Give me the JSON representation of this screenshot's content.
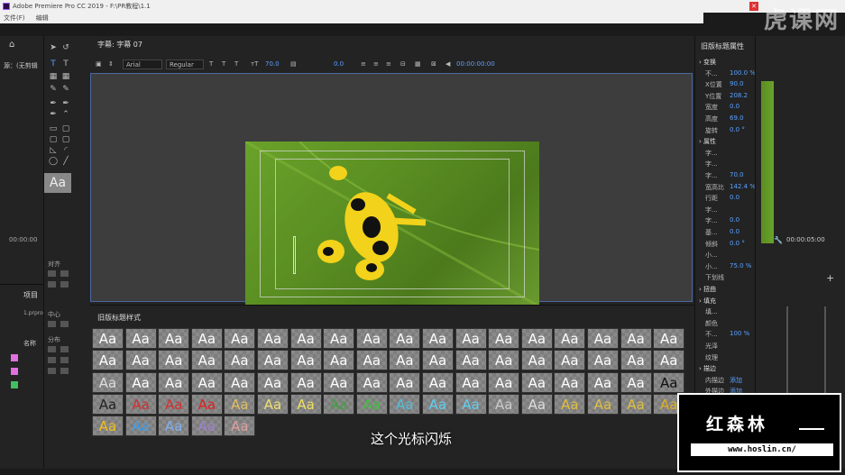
{
  "window": {
    "title": "Adobe Premiere Pro CC 2019 - F:\\PR教程\\1.1"
  },
  "watermark": "虎课网",
  "menu": [
    "文件(F)",
    "编辑"
  ],
  "source_panel": {
    "label": "源：(无剪辑",
    "timecode": "00:00:00"
  },
  "tools_panel": {
    "align_label": "对齐",
    "center_label": "中心",
    "distribute_label": "分布",
    "aa_label": "Aa"
  },
  "project_panel": {
    "tab": "项目",
    "file": "1.prpro",
    "name_col": "名称"
  },
  "title_panel": {
    "tab": "字幕: 字幕 07",
    "font_family": "Arial",
    "font_style": "Regular",
    "font_size": "70.0",
    "kerning": "0.0",
    "timecode": "00:00:00:00"
  },
  "styles_panel": {
    "tab": "旧版标题样式",
    "rows": [
      [
        "Aa",
        "Aa",
        "Aa",
        "Aa",
        "Aa",
        "Aa",
        "Aa",
        "Aa",
        "Aa",
        "Aa",
        "Aa",
        "Aa",
        "Aa",
        "Aa",
        "Aa",
        "Aa",
        "Aa",
        "Aa"
      ],
      [
        "Aa",
        "Aa",
        "Aa",
        "Aa",
        "Aa",
        "Aa",
        "Aa",
        "Aa",
        "Aa",
        "Aa",
        "Aa",
        "Aa",
        "Aa",
        "Aa",
        "Aa",
        "Aa",
        "Aa",
        "Aa"
      ],
      [
        "Aa",
        "Aa",
        "Aa",
        "Aa",
        "Aa",
        "Aa",
        "Aa",
        "Aa",
        "Aa",
        "Aa",
        "Aa",
        "Aa",
        "Aa",
        "Aa",
        "Aa",
        "Aa",
        "Aa",
        "Aa"
      ],
      [
        "Aa",
        "Aa",
        "Aa",
        "Aa",
        "Aa",
        "Aa",
        "Aa",
        "Aa",
        "Aa",
        "Aa",
        "Aa",
        "Aa",
        "Aa",
        "Aa",
        "Aa",
        "Aa",
        "Aa",
        "Aa"
      ],
      [
        "Aa",
        "Aa",
        "Aa",
        "Aa",
        "Aa"
      ]
    ],
    "colors": [
      [
        "#ffffff",
        "#ffffff",
        "#ffffff",
        "#ffffff",
        "#ffffff",
        "#ffffff",
        "#ffffff",
        "#ffffff",
        "#ffffff",
        "#ffffff",
        "#ffffff",
        "#ffffff",
        "#ffffff",
        "#ffffff",
        "#ffffff",
        "#ffffff",
        "#ffffff",
        "#ffffff"
      ],
      [
        "#ffffff",
        "#ffffff",
        "#ffffff",
        "#ffffff",
        "#ffffff",
        "#ffffff",
        "#ffffff",
        "#ffffff",
        "#ffffff",
        "#ffffff",
        "#ffffff",
        "#ffffff",
        "#ffffff",
        "#ffffff",
        "#ffffff",
        "#ffffff",
        "#ffffff",
        "#ffffff"
      ],
      [
        "#dddddd",
        "#ffffff",
        "#ffffff",
        "#ffffff",
        "#ffffff",
        "#ffffff",
        "#ffffff",
        "#ffffff",
        "#ffffff",
        "#ffffff",
        "#ffffff",
        "#ffffff",
        "#ffffff",
        "#ffffff",
        "#ffffff",
        "#ffffff",
        "#ffffff",
        "#111111"
      ],
      [
        "#222222",
        "#d03030",
        "#d03030",
        "#e02020",
        "#e0c060",
        "#f0e070",
        "#f0e060",
        "#40a040",
        "#40c040",
        "#50c0e0",
        "#60d0f0",
        "#60d0f0",
        "#cccccc",
        "#dddddd",
        "#e0c040",
        "#e0c040",
        "#e0c040",
        "#e0b020"
      ],
      [
        "#f0c020",
        "#40a0f0",
        "#80b0f0",
        "#a080d0",
        "#e0a0a0"
      ]
    ]
  },
  "properties_panel": {
    "tab": "旧版标题属性",
    "rows": [
      {
        "label": "变换",
        "value": "",
        "section": true
      },
      {
        "label": "不...",
        "value": "100.0 %"
      },
      {
        "label": "X位置",
        "value": "90.0"
      },
      {
        "label": "Y位置",
        "value": "208.2"
      },
      {
        "label": "宽度",
        "value": "0.0"
      },
      {
        "label": "高度",
        "value": "69.0"
      },
      {
        "label": "旋转",
        "value": "0.0 °"
      },
      {
        "label": "属性",
        "value": "",
        "section": true
      },
      {
        "label": "字...",
        "value": ""
      },
      {
        "label": "字...",
        "value": ""
      },
      {
        "label": "字...",
        "value": "70.0"
      },
      {
        "label": "宽高比",
        "value": "142.4 %"
      },
      {
        "label": "行距",
        "value": "0.0"
      },
      {
        "label": "字...",
        "value": ""
      },
      {
        "label": "字...",
        "value": "0.0"
      },
      {
        "label": "基...",
        "value": "0.0"
      },
      {
        "label": "倾斜",
        "value": "0.0 °"
      },
      {
        "label": "小...",
        "value": ""
      },
      {
        "label": "小...",
        "value": "75.0 %"
      },
      {
        "label": "下划线",
        "value": ""
      },
      {
        "label": "扭曲",
        "value": "",
        "section": true
      },
      {
        "label": "填充",
        "value": "",
        "section": true
      },
      {
        "label": "填...",
        "value": ""
      },
      {
        "label": "颜色",
        "value": ""
      },
      {
        "label": "不...",
        "value": "100 %"
      },
      {
        "label": "光泽",
        "value": ""
      },
      {
        "label": "纹理",
        "value": ""
      },
      {
        "label": "描边",
        "value": "",
        "section": true
      },
      {
        "label": "内描边",
        "value": "添加"
      },
      {
        "label": "外描边",
        "value": "添加"
      },
      {
        "label": "阴影",
        "value": ""
      }
    ]
  },
  "program_monitor": {
    "timecode": "00:00:05:00"
  },
  "subtitle": "这个光标闪烁",
  "brand": {
    "name": "红森林",
    "url": "www.hoslin.cn/"
  }
}
